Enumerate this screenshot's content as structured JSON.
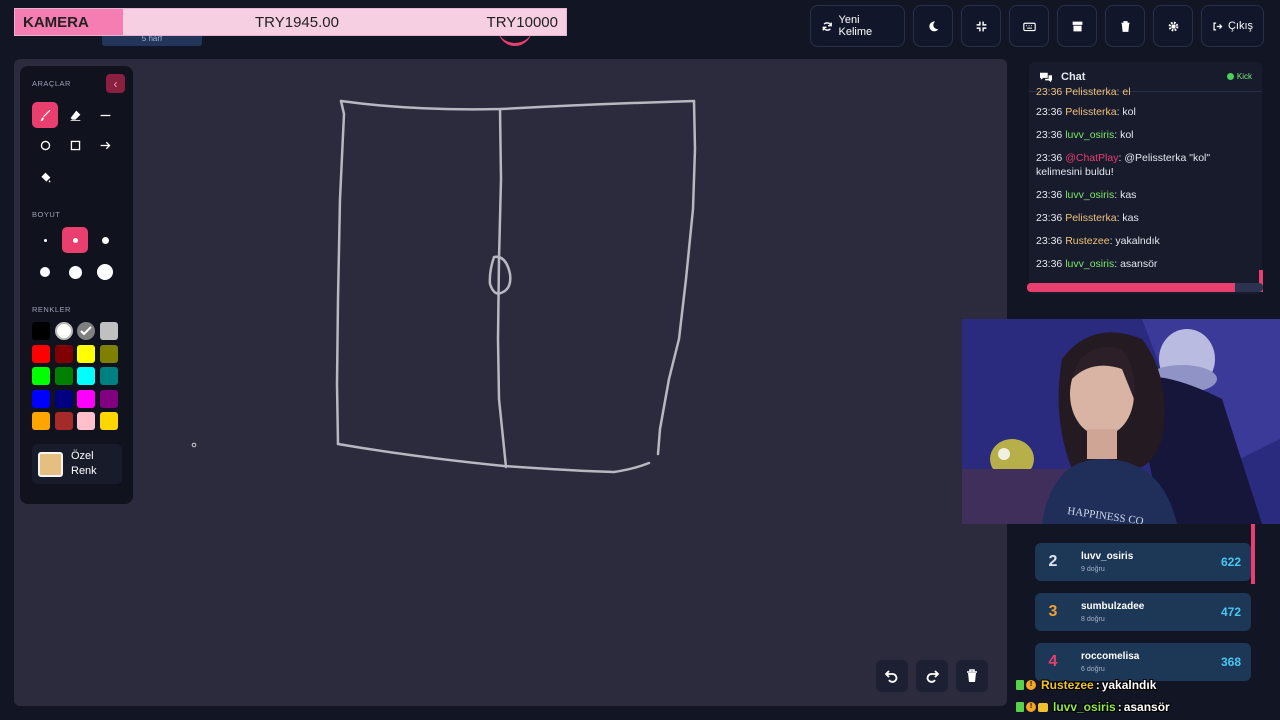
{
  "goal": {
    "label": "KAMERA",
    "current": "TRY1945.00",
    "target": "TRY10000",
    "progress": 0.1945
  },
  "hidden_badge": "5 harf",
  "toolbar": {
    "new_word": "Yeni Kelime",
    "logout": "Çıkış"
  },
  "tools": {
    "title": "ARAÇLAR",
    "size_title": "BOYUT",
    "colors_title": "RENKLER",
    "custom_label_1": "Özel",
    "custom_label_2": "Renk",
    "colors": [
      "#000000",
      "#ffffff",
      "#808080",
      "#c0c0c0",
      "#ff0000",
      "#800000",
      "#ffff00",
      "#808000",
      "#00ff00",
      "#008000",
      "#00ffff",
      "#008080",
      "#0000ff",
      "#000080",
      "#ff00ff",
      "#800080",
      "#ffa500",
      "#a52a2a",
      "#ffc0cb",
      "#ffd700"
    ],
    "custom_color": "#e5bf82"
  },
  "chat": {
    "title": "Chat",
    "platform": "Kick",
    "partial_top": "23:36 Pelissterka: el",
    "messages": [
      {
        "time": "23:36",
        "user": "Pelissterka",
        "color": "#f0c27a",
        "text": "kol"
      },
      {
        "time": "23:36",
        "user": "luvv_osiris",
        "color": "#7be86a",
        "text": "kol"
      },
      {
        "time": "23:36",
        "user": "@ChatPlay",
        "color": "#e83f6f",
        "text": "@Pelissterka \"kol\" kelimesini buldu!"
      },
      {
        "time": "23:36",
        "user": "luvv_osiris",
        "color": "#7be86a",
        "text": "kas"
      },
      {
        "time": "23:36",
        "user": "Pelissterka",
        "color": "#f0c27a",
        "text": "kas"
      },
      {
        "time": "23:36",
        "user": "Rustezee",
        "color": "#f0c27a",
        "text": "yakalndık"
      },
      {
        "time": "23:36",
        "user": "luvv_osiris",
        "color": "#7be86a",
        "text": "asansör"
      }
    ],
    "timer_progress": 0.88
  },
  "leaderboard": [
    {
      "rank": "2",
      "rank_color": "#dfe3ee",
      "name": "luvv_osiris",
      "sub": "9 doğru",
      "score": "622"
    },
    {
      "rank": "3",
      "rank_color": "#f0a030",
      "name": "sumbulzadee",
      "sub": "8 doğru",
      "score": "472"
    },
    {
      "rank": "4",
      "rank_color": "#e83f6f",
      "name": "roccomelisa",
      "sub": "6 doğru",
      "score": "368"
    }
  ],
  "overlay_chat": [
    {
      "user": "Rustezee",
      "user_color": "#f0c12e",
      "text": "yakalndık"
    },
    {
      "user": "luvv_osiris",
      "user_color": "#8fe84a",
      "text": "asansör"
    }
  ]
}
